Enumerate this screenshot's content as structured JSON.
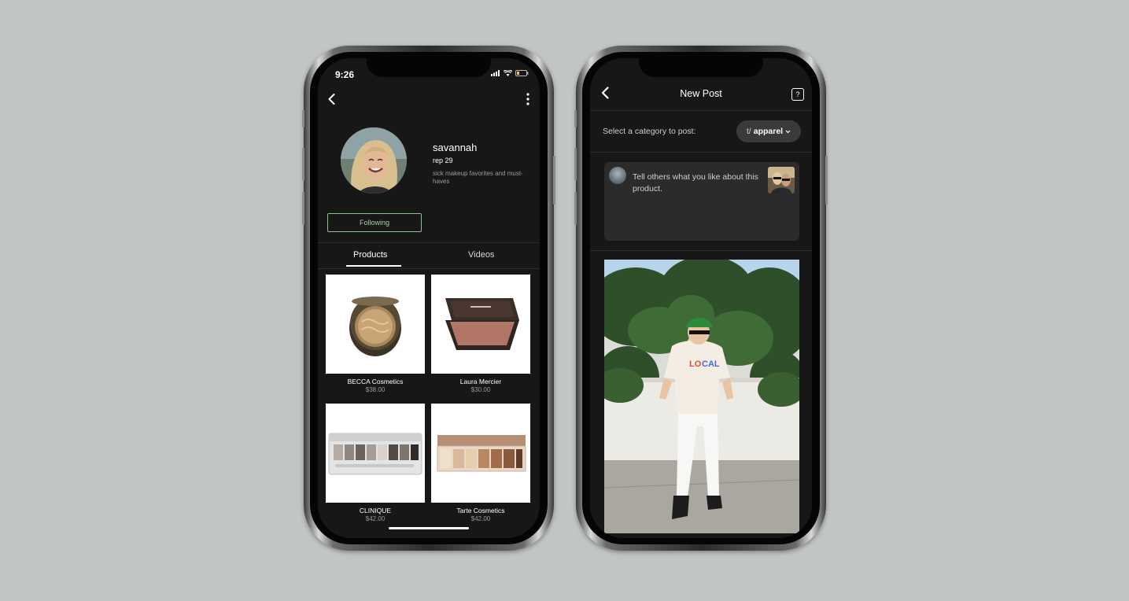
{
  "profile_screen": {
    "status_time": "9:26",
    "username": "savannah",
    "rep": "rep 29",
    "bio": "sick makeup favorites and must-haves",
    "follow_button": "Following",
    "tabs": [
      {
        "label": "Products",
        "active": true
      },
      {
        "label": "Videos",
        "active": false
      }
    ],
    "products": [
      {
        "brand": "BECCA Cosmetics",
        "price": "$38.00",
        "image": "compact-powder"
      },
      {
        "brand": "Laura Mercier",
        "price": "$30.00",
        "image": "blush-compact"
      },
      {
        "brand": "CLINIQUE",
        "price": "$42.00",
        "image": "eyeshadow-palette-grey"
      },
      {
        "brand": "Tarte Cosmetics",
        "price": "$42.00",
        "image": "eyeshadow-palette-nude"
      }
    ],
    "icons": {
      "back": "chevron-left-icon",
      "more": "more-vertical-icon",
      "signal": "signal-icon",
      "wifi": "wifi-icon",
      "battery": "battery-icon"
    }
  },
  "new_post_screen": {
    "title": "New Post",
    "category_label": "Select a category to post:",
    "category_prefix": "t/",
    "category_value": "apparel",
    "compose_placeholder": "Tell others what you like about this product.",
    "icons": {
      "back": "chevron-left-icon",
      "help": "help-icon",
      "dropdown": "chevron-down-icon"
    }
  },
  "colors": {
    "background": "#c2c5c5",
    "screen": "#171717",
    "following_accent": "#a9d3a3"
  }
}
